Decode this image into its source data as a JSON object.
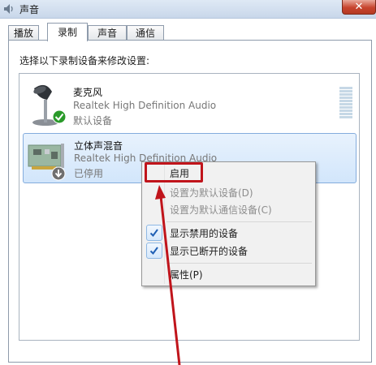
{
  "window": {
    "title": "声音",
    "close_label": "✕"
  },
  "tabs": [
    {
      "label": "播放",
      "active": false
    },
    {
      "label": "录制",
      "active": true
    },
    {
      "label": "声音",
      "active": false
    },
    {
      "label": "通信",
      "active": false
    }
  ],
  "instruction": "选择以下录制设备来修改设置:",
  "devices": [
    {
      "name": "麦克风",
      "driver": "Realtek High Definition Audio",
      "status": "默认设备",
      "icon": "microphone-icon",
      "badge": "green-check"
    },
    {
      "name": "立体声混音",
      "driver": "Realtek High Definition Audio",
      "status": "已停用",
      "icon": "sound-card-icon",
      "badge": "disabled-arrow"
    }
  ],
  "context_menu": {
    "items": [
      {
        "label": "启用",
        "enabled": true,
        "checked": false
      },
      {
        "label": "设置为默认设备(D)",
        "enabled": false,
        "checked": false
      },
      {
        "label": "设置为默认通信设备(C)",
        "enabled": false,
        "checked": false
      },
      {
        "label": "显示禁用的设备",
        "enabled": true,
        "checked": true
      },
      {
        "label": "显示已断开的设备",
        "enabled": true,
        "checked": true
      },
      {
        "label": "属性(P)",
        "enabled": true,
        "checked": false
      }
    ]
  },
  "colors": {
    "annotation_red": "#c0141b",
    "selection_bg": "#d2e6fb",
    "check_blue": "#1f5fb4"
  }
}
